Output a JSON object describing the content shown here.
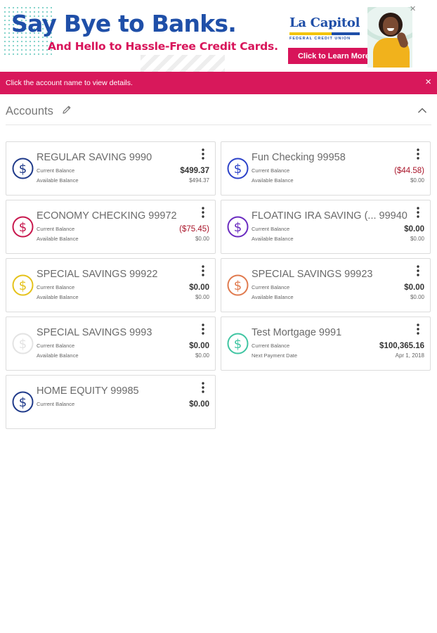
{
  "banner": {
    "headline": "Say Bye to Banks.",
    "subline": "And Hello to Hassle-Free Credit Cards.",
    "brand_name": "La Capitol",
    "brand_sub": "FEDERAL CREDIT UNION",
    "cta_label": "Click to Learn More",
    "close_glyph": "✕"
  },
  "notice": {
    "message": "Click the account name to view details.",
    "close_glyph": "×"
  },
  "accounts_header": {
    "title": "Accounts"
  },
  "accounts": [
    {
      "name": "REGULAR SAVING 9990",
      "icon_color": "#1f3a8a",
      "label1": "Current Balance",
      "value1": "$499.37",
      "value1_negative": false,
      "label2": "Available Balance",
      "value2": "$494.37"
    },
    {
      "name": "Fun Checking 99958",
      "icon_color": "#2c42c9",
      "label1": "Current Balance",
      "value1": "($44.58)",
      "value1_negative": true,
      "label2": "Available Balance",
      "value2": "$0.00"
    },
    {
      "name": "ECONOMY CHECKING 99972",
      "icon_color": "#c8174d",
      "label1": "Current Balance",
      "value1": "($75.45)",
      "value1_negative": true,
      "label2": "Available Balance",
      "value2": "$0.00"
    },
    {
      "name": "FLOATING IRA SAVING (... 99940",
      "icon_color": "#6a2bc0",
      "label1": "Current Balance",
      "value1": "$0.00",
      "value1_negative": false,
      "label2": "Available Balance",
      "value2": "$0.00"
    },
    {
      "name": "SPECIAL SAVINGS 99922",
      "icon_color": "#e5c21a",
      "label1": "Current Balance",
      "value1": "$0.00",
      "value1_negative": false,
      "label2": "Available Balance",
      "value2": "$0.00"
    },
    {
      "name": "SPECIAL SAVINGS 99923",
      "icon_color": "#e07a4e",
      "label1": "Current Balance",
      "value1": "$0.00",
      "value1_negative": false,
      "label2": "Available Balance",
      "value2": "$0.00"
    },
    {
      "name": "SPECIAL SAVINGS 9993",
      "icon_color": "#e3e3e3",
      "label1": "Current Balance",
      "value1": "$0.00",
      "value1_negative": false,
      "label2": "Available Balance",
      "value2": "$0.00"
    },
    {
      "name": "Test Mortgage 9991",
      "icon_color": "#3fc5a2",
      "label1": "Current Balance",
      "value1": "$100,365.16",
      "value1_negative": false,
      "label2": "Next Payment Date",
      "value2": "Apr 1, 2018"
    },
    {
      "name": "HOME EQUITY 99985",
      "icon_color": "#1f3a8a",
      "label1": "Current Balance",
      "value1": "$0.00",
      "value1_negative": false,
      "label2": "",
      "value2": ""
    }
  ]
}
